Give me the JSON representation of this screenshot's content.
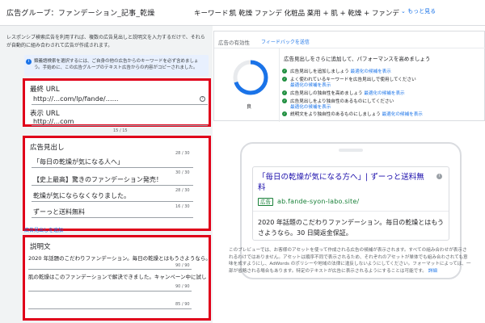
{
  "header": {
    "adgroup": "広告グループ：ファンデーション_記事_乾燥",
    "keyword_label": "キーワード：",
    "keyword_value": "肌 乾燥 ファンデ 化粧品 薬用 + 肌 + 乾燥 + ファンデ",
    "more_link": "もっと見る"
  },
  "left": {
    "description": "レスポンシブ検索広告を利用すれば、複数の広告見出しと説明文を入力するだけで、それらが自動的に組み合わされて広告が作成されます。",
    "info_text": "類義語検索を選択するには、ご自身の他の広告からのキーワードを必ず含めましょう。手始めに、この広告グループのテキスト広告からの内容がコピーされました。",
    "final_url": {
      "label": "最終 URL",
      "value": "http://...com/lp/fande/......"
    },
    "display_url": {
      "label": "表示 URL",
      "value": "http://...com",
      "counter": "15 / 15"
    },
    "headlines": {
      "label": "広告見出し",
      "items": [
        {
          "text": "「毎日の乾燥が気になる人へ」",
          "counter": "28 / 30"
        },
        {
          "text": "【史上最高】驚きのファンデーション発売！",
          "counter": "30 / 30"
        },
        {
          "text": "乾燥が気にならなくなりました。",
          "counter": "28 / 30"
        },
        {
          "text": "ずーっと送料無料",
          "counter": "16 / 30"
        }
      ],
      "add_link": "広告見出しを追加"
    },
    "descriptions": {
      "label": "説明文",
      "items": [
        {
          "text": "2020 年話題のこだわりファンデーション。毎日の乾燥とはもうさようなら。",
          "counter": "90 / 90"
        },
        {
          "text": "肌の乾燥はこのファンデーションで解決できました。キャンペーン中に試し",
          "counter": "90 / 90"
        },
        {
          "text": "",
          "counter": "85 / 90"
        }
      ]
    }
  },
  "effectiveness": {
    "title": "広告の有効性",
    "feedback_link": "フィードバックを送信",
    "rating": "良",
    "rating_fraction": 0.7,
    "tip": "広告見出しをさらに追加して、パフォーマンスを高めましょう",
    "checks": [
      {
        "text": "広告見出しを追加しましょう",
        "link": "最適化の候補を表示",
        "sub": ""
      },
      {
        "text": "よく使われているキーワードを広告見出しで使用してください",
        "link": "",
        "sub": "最適化の候補を表示"
      },
      {
        "text": "広告見出しの独自性を高めましょう",
        "link": "最適化の候補を表示",
        "sub": ""
      },
      {
        "text": "広告見出しをより独自性のあるものにしてください",
        "link": "",
        "sub": "最適化の候補を表示"
      },
      {
        "text": "説明文をより独自性のあるものにしましょう",
        "link": "最適化の候補を表示",
        "sub": ""
      }
    ],
    "colors": {
      "gauge": "#1a73e8",
      "check": "#1e8e3e"
    }
  },
  "preview": {
    "title": "「毎日の乾燥が気になる方へ」| ずーっと送料無料",
    "badge": "広告",
    "url": "ab.fande-syon-labo.site/",
    "description": "2020 年話題のこだわりファンデーション。毎日の乾燥とはもうさようなら。30 日間返金保証。",
    "note": "このプレビューでは、お客様のアセットを使って作成される広告の候補が表示されます。すべての組み合わせが表示されるわけではありません。アセットは順序不同で表示されるため、それぞれのアセットが単体でも組み合わされても意味を成すようにし、AdWords のポリシーや地域の法律に違反しないようにしてください。フォーマットによっては、一部が省略される場合もあります。特定のテキストが広告に表示されるようにすることは可能です。",
    "note_link": "詳細"
  },
  "accent": {
    "highlight": "#e0001a",
    "link": "#1a73e8"
  }
}
